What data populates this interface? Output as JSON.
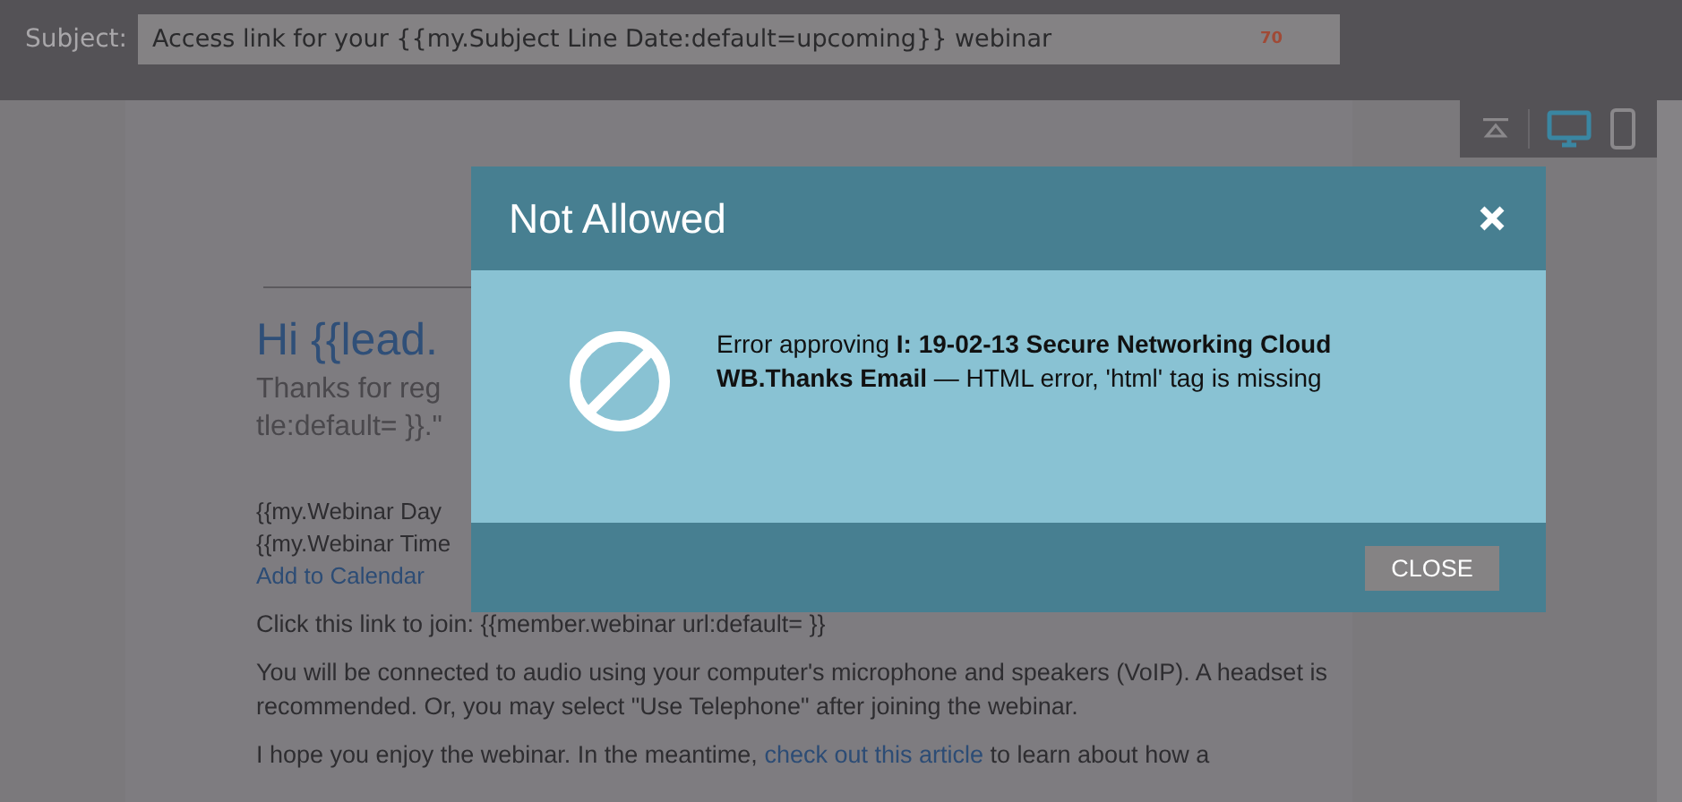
{
  "subject": {
    "label": "Subject:",
    "value": "Access link for your {{my.Subject Line Date:default=upcoming}} webinar",
    "count": "70"
  },
  "view_toolbar": {
    "devices": [
      {
        "kind": "desktop",
        "selected": true
      },
      {
        "kind": "mobile",
        "selected": false
      }
    ]
  },
  "email_preview": {
    "heading": "Hi {{lead.",
    "intro_lines": [
      "Thanks for reg",
      "tle:default= }}.\""
    ],
    "detail_lines": [
      "{{my.Webinar Day",
      "{{my.Webinar Time"
    ],
    "calendar_link": "Add to Calendar",
    "join_text": "Click this link to join: {{member.webinar url:default= }}",
    "audio_text": "You will be connected to audio using your computer's microphone and speakers (VoIP). A headset is recommended. Or, you may select \"Use Telephone\" after joining the webinar.",
    "closing_before": "I hope you enjoy the webinar. In the meantime,",
    "closing_link": "check out this article",
    "closing_after": "to learn about how a"
  },
  "dialog": {
    "title": "Not Allowed",
    "message": "Error approving **I: 19-02-13 Secure Networking Cloud WB.Thanks Email** — HTML error, 'html' tag is missing",
    "buttons": [
      "CLOSE"
    ]
  }
}
